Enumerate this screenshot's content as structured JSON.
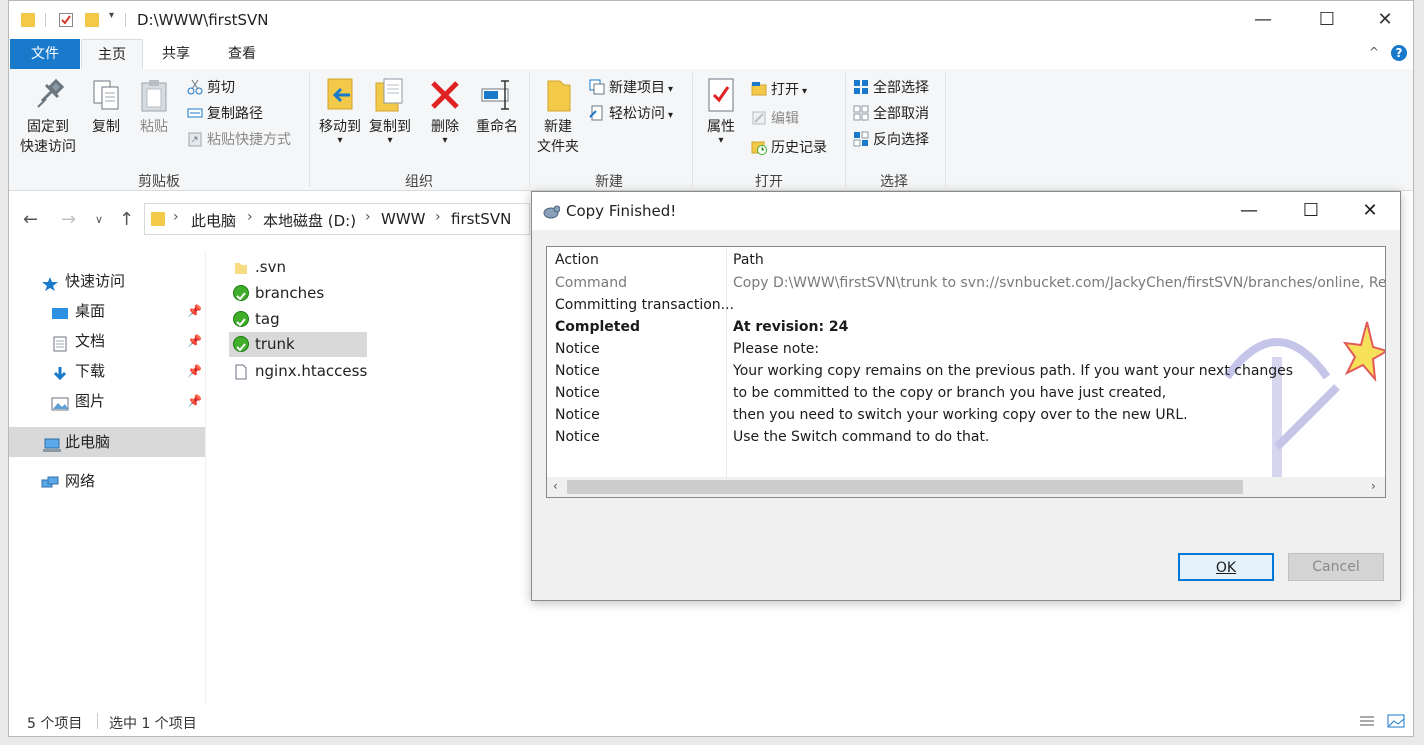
{
  "window": {
    "title": "D:\\WWW\\firstSVN",
    "minimize": "—",
    "maximize": "☐",
    "close": "✕"
  },
  "ribbon": {
    "tabs": [
      "文件",
      "主页",
      "共享",
      "查看"
    ],
    "help": "?",
    "clipboard": {
      "pin": "固定到\n快速访问",
      "pin_line1": "固定到",
      "pin_line2": "快速访问",
      "copy": "复制",
      "paste": "粘贴",
      "cut": "剪切",
      "copy_path": "复制路径",
      "paste_shortcut": "粘贴快捷方式",
      "label": "剪贴板"
    },
    "organize": {
      "move_to": "移动到",
      "copy_to": "复制到",
      "delete": "删除",
      "rename": "重命名",
      "label": "组织"
    },
    "new": {
      "new_folder_line1": "新建",
      "new_folder_line2": "文件夹",
      "new_item": "新建项目",
      "easy_access": "轻松访问",
      "label": "新建"
    },
    "open": {
      "properties": "属性",
      "open": "打开",
      "edit": "编辑",
      "history": "历史记录",
      "label": "打开"
    },
    "select": {
      "select_all": "全部选择",
      "select_none": "全部取消",
      "invert": "反向选择",
      "label": "选择"
    }
  },
  "address": {
    "crumbs": [
      "此电脑",
      "本地磁盘 (D:)",
      "WWW",
      "firstSVN"
    ]
  },
  "sidebar": {
    "items": [
      {
        "label": "快速访问"
      },
      {
        "label": "桌面"
      },
      {
        "label": "文档"
      },
      {
        "label": "下载"
      },
      {
        "label": "图片"
      },
      {
        "label": "此电脑"
      },
      {
        "label": "网络"
      }
    ]
  },
  "files": [
    {
      "name": ".svn"
    },
    {
      "name": "branches"
    },
    {
      "name": "tag"
    },
    {
      "name": "trunk"
    },
    {
      "name": "nginx.htaccess"
    }
  ],
  "status": {
    "count": "5 个项目",
    "selected": "选中 1 个项目"
  },
  "dialog": {
    "title": "Copy Finished!",
    "headers": {
      "action": "Action",
      "path": "Path"
    },
    "rows": [
      {
        "action": "Command",
        "path": "Copy D:\\WWW\\firstSVN\\trunk to svn://svnbucket.com/JackyChen/firstSVN/branches/online, Revisio"
      },
      {
        "action": "Committing transaction...",
        "path": ""
      },
      {
        "action": "Completed",
        "path": "At revision: 24"
      },
      {
        "action": "Notice",
        "path": "Please note:"
      },
      {
        "action": "Notice",
        "path": "Your working copy remains on the previous path. If you want your next changes"
      },
      {
        "action": "Notice",
        "path": "to be committed to the copy or branch you have just created,"
      },
      {
        "action": "Notice",
        "path": "then you need to switch your working copy over to the new URL."
      },
      {
        "action": "Notice",
        "path": "Use the Switch command to do that."
      }
    ],
    "ok": "OK",
    "cancel": "Cancel"
  },
  "colors": {
    "accent": "#1979ca",
    "svn_ok": "#3fae2a",
    "folder": "#f3c94a"
  }
}
